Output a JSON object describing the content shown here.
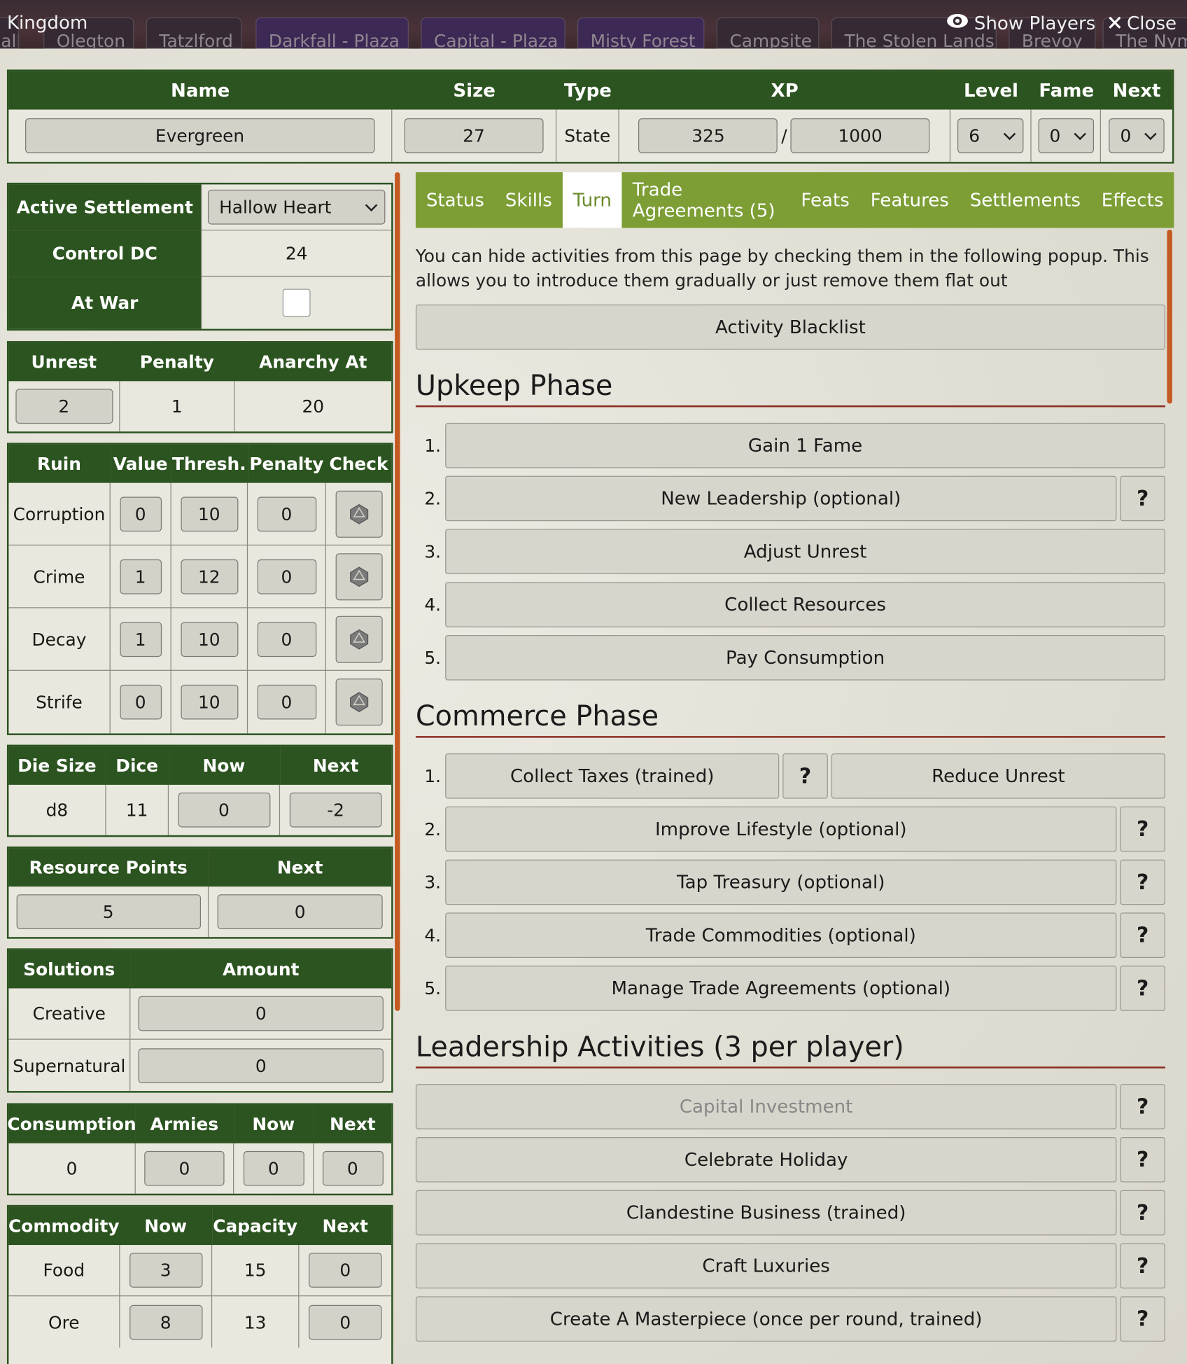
{
  "window": {
    "title": "Kingdom",
    "show_players": "Show Players",
    "close": "Close"
  },
  "scene_tabs": [
    "all",
    "Olegton",
    "Tatzlford",
    "Darkfall - Plaza",
    "Capital - Plaza",
    "Misty Forest",
    "Campsite",
    "The Stolen Lands",
    "Brevoy",
    "The Nym"
  ],
  "header": {
    "labels": {
      "name": "Name",
      "size": "Size",
      "type": "Type",
      "xp": "XP",
      "level": "Level",
      "fame": "Fame",
      "next": "Next"
    },
    "name": "Evergreen",
    "size": "27",
    "type": "State",
    "xp": "325",
    "xp_sep": "/",
    "xp_max": "1000",
    "level": "6",
    "fame": "0",
    "next": "0"
  },
  "settlement": {
    "active_label": "Active Settlement",
    "active_value": "Hallow Heart",
    "control_dc_label": "Control DC",
    "control_dc": "24",
    "at_war_label": "At War",
    "at_war": false
  },
  "unrest": {
    "labels": [
      "Unrest",
      "Penalty",
      "Anarchy At"
    ],
    "unrest": "2",
    "penalty": "1",
    "anarchy_at": "20"
  },
  "ruin": {
    "labels": [
      "Ruin",
      "Value",
      "Thresh.",
      "Penalty",
      "Check"
    ],
    "rows": [
      {
        "name": "Corruption",
        "value": "0",
        "thresh": "10",
        "penalty": "0"
      },
      {
        "name": "Crime",
        "value": "1",
        "thresh": "12",
        "penalty": "0"
      },
      {
        "name": "Decay",
        "value": "1",
        "thresh": "10",
        "penalty": "0"
      },
      {
        "name": "Strife",
        "value": "0",
        "thresh": "10",
        "penalty": "0"
      }
    ]
  },
  "dice": {
    "labels": [
      "Die Size",
      "Dice",
      "Now",
      "Next"
    ],
    "die_size": "d8",
    "dice": "11",
    "now": "0",
    "next": "-2"
  },
  "resource_points": {
    "labels": [
      "Resource Points",
      "Next"
    ],
    "value": "5",
    "next": "0"
  },
  "solutions": {
    "labels": [
      "Solutions",
      "Amount"
    ],
    "rows": [
      {
        "name": "Creative",
        "amount": "0"
      },
      {
        "name": "Supernatural",
        "amount": "0"
      }
    ]
  },
  "consumption": {
    "labels": [
      "Consumption",
      "Armies",
      "Now",
      "Next"
    ],
    "consumption": "0",
    "armies": "0",
    "now": "0",
    "next": "0"
  },
  "commodity": {
    "labels": [
      "Commodity",
      "Now",
      "Capacity",
      "Next"
    ],
    "rows": [
      {
        "name": "Food",
        "now": "3",
        "capacity": "15",
        "next": "0"
      },
      {
        "name": "Ore",
        "now": "8",
        "capacity": "13",
        "next": "0"
      }
    ]
  },
  "tabs": [
    "Status",
    "Skills",
    "Turn",
    "Trade Agreements (5)",
    "Feats",
    "Features",
    "Settlements",
    "Effects"
  ],
  "turn": {
    "intro": "You can hide activities from this page by checking them in the following popup. This allows you to introduce them gradually or just remove them flat out",
    "blacklist": "Activity Blacklist",
    "upkeep_title": "Upkeep Phase",
    "upkeep": [
      "Gain 1 Fame",
      "New Leadership (optional)",
      "Adjust Unrest",
      "Collect Resources",
      "Pay Consumption"
    ],
    "commerce_title": "Commerce Phase",
    "commerce": [
      "Collect Taxes (trained)",
      "Improve Lifestyle (optional)",
      "Tap Treasury (optional)",
      "Trade Commodities (optional)",
      "Manage Trade Agreements (optional)"
    ],
    "reduce_unrest": "Reduce Unrest",
    "leadership_title": "Leadership Activities (3 per player)",
    "leadership": [
      "Capital Investment",
      "Celebrate Holiday",
      "Clandestine Business (trained)",
      "Craft Luxuries",
      "Create A Masterpiece (once per round, trained)"
    ],
    "help": "?",
    "nums": [
      "1.",
      "2.",
      "3.",
      "4.",
      "5."
    ]
  }
}
